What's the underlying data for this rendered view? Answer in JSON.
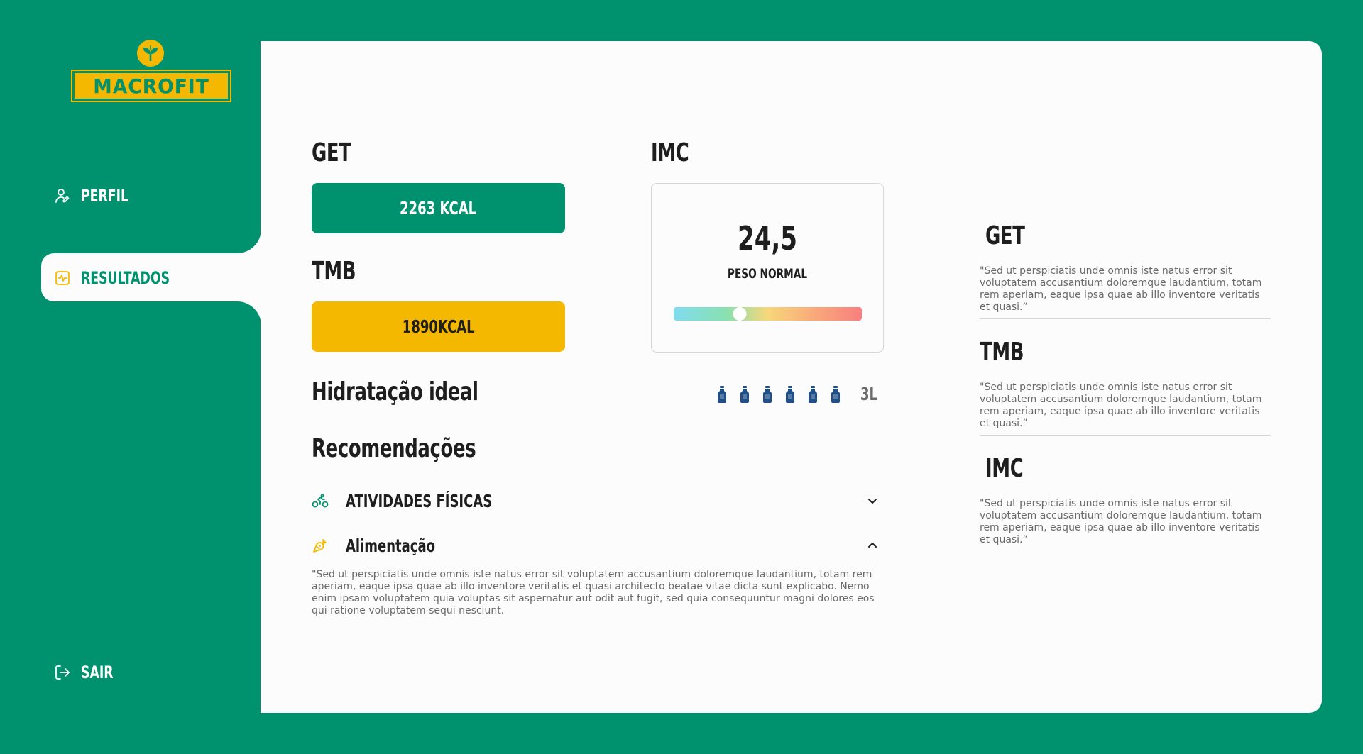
{
  "brand": {
    "name": "MACROFIT",
    "primary_color": "#00926e",
    "accent_color": "#f5b800"
  },
  "nav": {
    "profile": {
      "label": "PERFIL",
      "icon": "user-edit-icon"
    },
    "results": {
      "label": "RESULTADOS",
      "icon": "activity-icon",
      "active": true
    },
    "logout": {
      "label": "SAIR",
      "icon": "logout-icon"
    }
  },
  "get": {
    "title": "GET",
    "value": "2263 KCAL"
  },
  "tmb": {
    "title": "TMB",
    "value": "1890KCAL"
  },
  "imc": {
    "title": "IMC",
    "value": "24,5",
    "status": "PESO NORMAL",
    "scale_position": 0.35
  },
  "hydration": {
    "title": "Hidratação ideal",
    "bottles": 6,
    "amount": "3L"
  },
  "recommendations": {
    "title": "Recomendações",
    "items": [
      {
        "label": "ATIVIDADES FÍSICAS",
        "icon": "bike-icon",
        "expanded": false
      },
      {
        "label": "Alimentação",
        "icon": "carrot-icon",
        "expanded": true,
        "text": "\"Sed ut perspiciatis unde omnis iste natus error sit voluptatem accusantium doloremque laudantium, totam rem aperiam, eaque ipsa quae ab illo inventore veritatis et quasi architecto beatae vitae dicta sunt explicabo. Nemo enim ipsam voluptatem quia voluptas sit aspernatur aut odit aut fugit, sed quia consequuntur magni dolores eos qui ratione voluptatem sequi nesciunt."
      }
    ]
  },
  "info": [
    {
      "title": "GET",
      "text": "\"Sed ut perspiciatis unde omnis iste natus error sit voluptatem accusantium doloremque laudantium, totam rem aperiam, eaque ipsa quae ab illo inventore veritatis et quasi.”"
    },
    {
      "title": "TMB",
      "text": "\"Sed ut perspiciatis unde omnis iste natus error sit voluptatem accusantium doloremque laudantium, totam rem aperiam, eaque ipsa quae ab illo inventore veritatis et quasi.”"
    },
    {
      "title": "IMC",
      "text": "\"Sed ut perspiciatis unde omnis iste natus error sit voluptatem accusantium doloremque laudantium, totam rem aperiam, eaque ipsa quae ab illo inventore veritatis et quasi.”"
    }
  ]
}
